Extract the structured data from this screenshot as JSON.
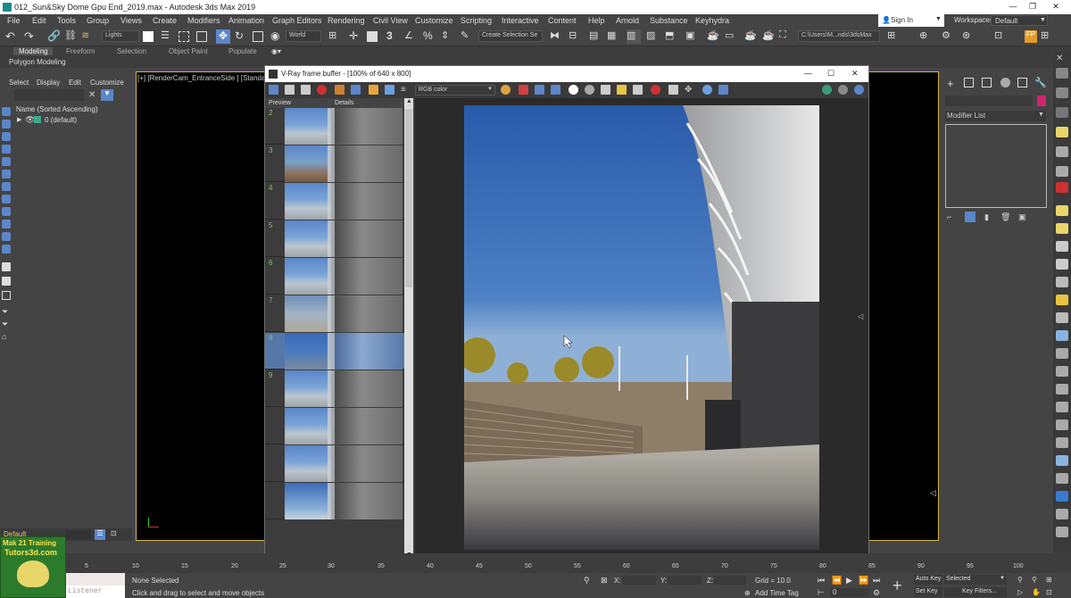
{
  "app": {
    "title": "012_Sun&Sky Dome Gpu End_2019.max - Autodesk 3ds Max 2019",
    "sign_in": "Sign In",
    "workspaces_label": "Workspaces:",
    "workspace_value": "Default"
  },
  "menu": [
    "File",
    "Edit",
    "Tools",
    "Group",
    "Views",
    "Create",
    "Modifiers",
    "Animation",
    "Graph Editors",
    "Rendering",
    "Civil View",
    "Customize",
    "Scripting",
    "Interactive",
    "Content",
    "Help",
    "Arnold",
    "Substance",
    "Keyhydra"
  ],
  "toolbar": {
    "lights_drop": "Lights",
    "world_drop": "World",
    "selection_set": "Create Selection Se",
    "path": "C:\\Users\\M...nds\\3dsMax"
  },
  "ribbon": {
    "tabs": [
      "Modeling",
      "Freeform",
      "Selection",
      "Object Paint",
      "Populate"
    ],
    "sub": "Polygon Modeling"
  },
  "scene_explorer": {
    "tabs": [
      "Select",
      "Display",
      "Edit",
      "Customize"
    ],
    "header": "Name (Sorted Ascending)",
    "root": "0 (default)",
    "bottom": "Default"
  },
  "viewport": {
    "label": "[+] [RenderCam_EntranceSide ] [Standard ] ["
  },
  "vfb": {
    "title": "V-Ray frame buffer - [100% of 640 x 800]",
    "channel": "RGB color",
    "hist_preview": "Preview",
    "hist_details": "Details",
    "history_numbers": [
      "2",
      "3",
      "4",
      "5",
      "6",
      "7",
      "8",
      "9",
      "",
      "",
      ""
    ]
  },
  "command_panel": {
    "modifier_list": "Modifier List"
  },
  "timeline": {
    "ticks": [
      "5",
      "10",
      "15",
      "20",
      "25",
      "30",
      "35",
      "40",
      "45",
      "50",
      "55",
      "60",
      "65",
      "70",
      "75",
      "80",
      "85",
      "90",
      "95",
      "100"
    ]
  },
  "status": {
    "none_selected": "None Selected",
    "hint": "Click and drag to select and move objects",
    "listener": "Listener",
    "x_label": "X:",
    "y_label": "Y:",
    "z_label": "Z:",
    "grid": "Grid = 10.0",
    "add_time_tag": "Add Time Tag",
    "auto_key": "Auto Key",
    "set_key": "Set Key",
    "selected": "Selected",
    "key_filters": "Key Filters...",
    "frame": "0"
  },
  "logo": {
    "line1": "Mak 21 Training",
    "line2": "Tutors3d.com"
  }
}
